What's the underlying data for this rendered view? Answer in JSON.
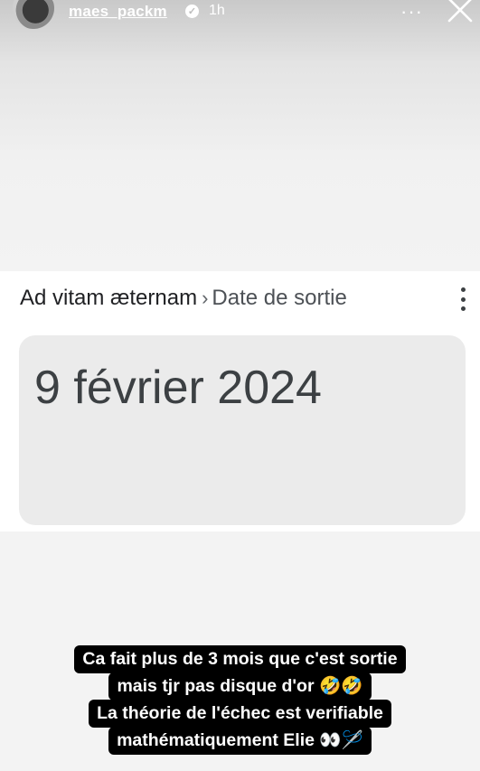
{
  "story": {
    "username": "maes_packm",
    "time": "1h",
    "more_label": "···"
  },
  "result": {
    "breadcrumb_parent": "Ad vitam æternam",
    "breadcrumb_separator": "›",
    "breadcrumb_current": "Date de sortie",
    "answer": "9 février 2024"
  },
  "caption": {
    "lines": [
      "Ca fait plus de 3 mois que c'est sortie",
      "mais tjr pas disque d'or 🤣🤣",
      "La théorie de l'échec est verifiable",
      "mathématiquement Elie 👀🪡"
    ]
  },
  "icons": {
    "verified": "verified-badge-icon",
    "close": "close-icon",
    "more": "more-options-icon",
    "kebab": "kebab-menu-icon"
  },
  "colors": {
    "caption_bg": "#000000",
    "caption_text": "#ffffff",
    "answer_box": "#ebebeb"
  }
}
